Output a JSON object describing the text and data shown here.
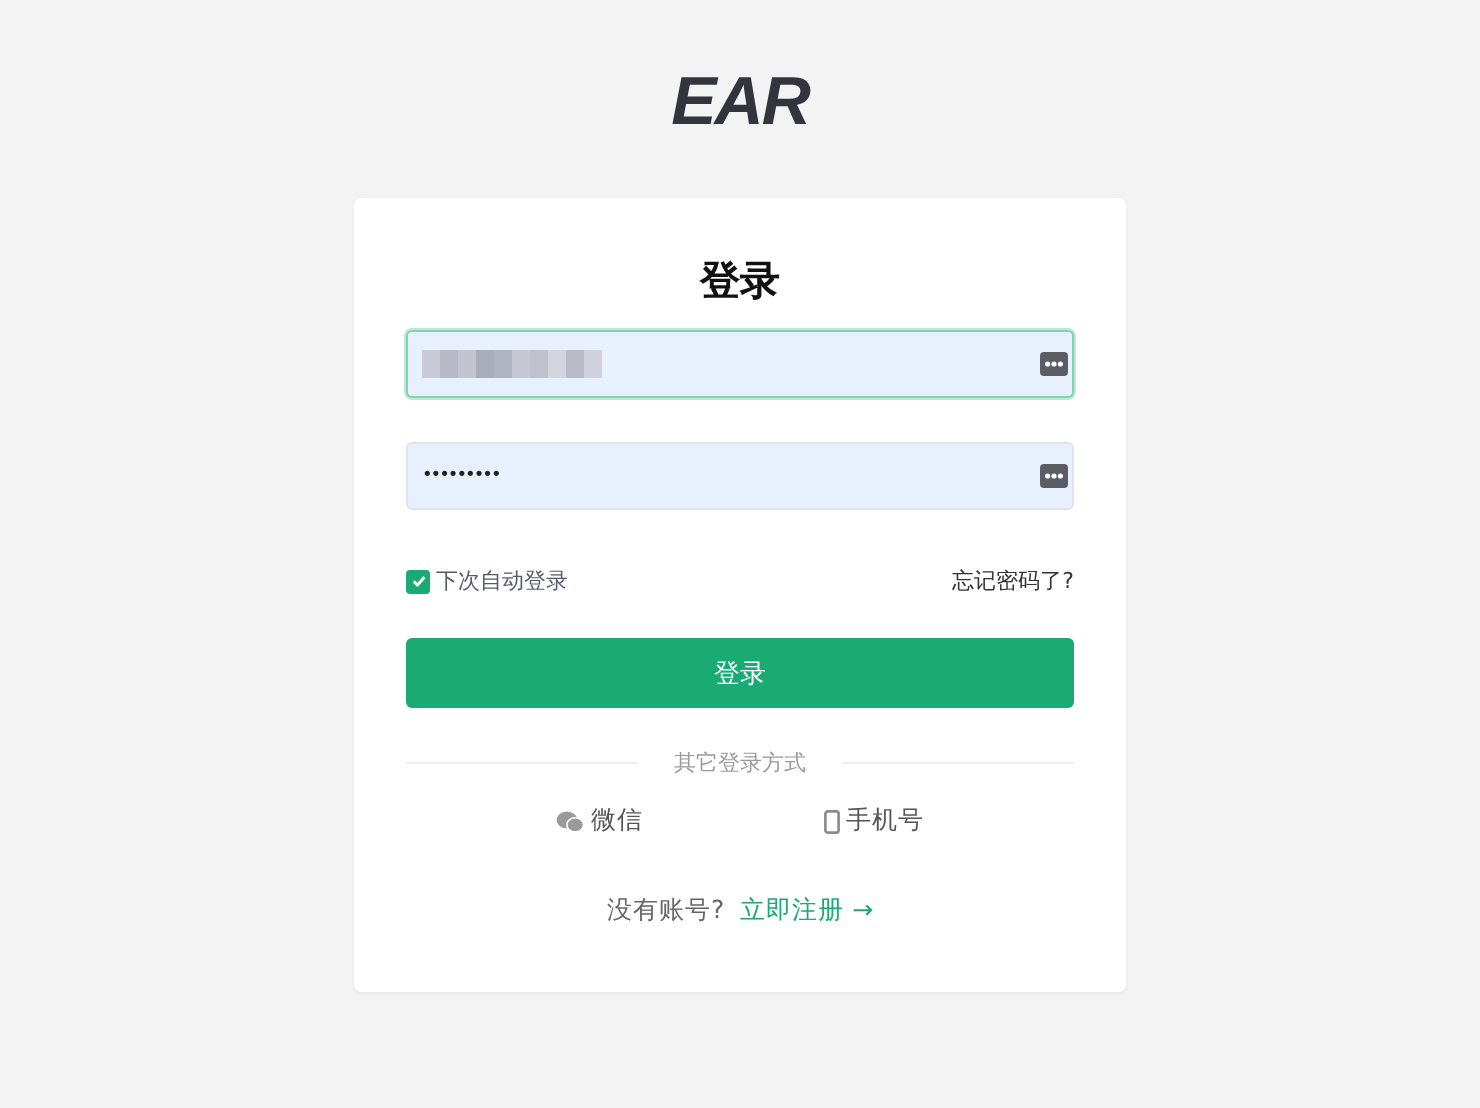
{
  "logo": {
    "text": "EAR"
  },
  "title": "登录",
  "fields": [
    {
      "kind": "redacted",
      "focused": true
    },
    {
      "kind": "password",
      "focused": false,
      "value": "•••••••••"
    }
  ],
  "remember": {
    "label": "下次自动登录",
    "checked": true
  },
  "forgot": "忘记密码了?",
  "submit": "登录",
  "divider": "其它登录方式",
  "alternatives": [
    {
      "kind": "wechat",
      "label": "微信"
    },
    {
      "kind": "phone",
      "label": "手机号"
    }
  ],
  "register": {
    "prompt": "没有账号?",
    "link": "立即注册 →"
  }
}
